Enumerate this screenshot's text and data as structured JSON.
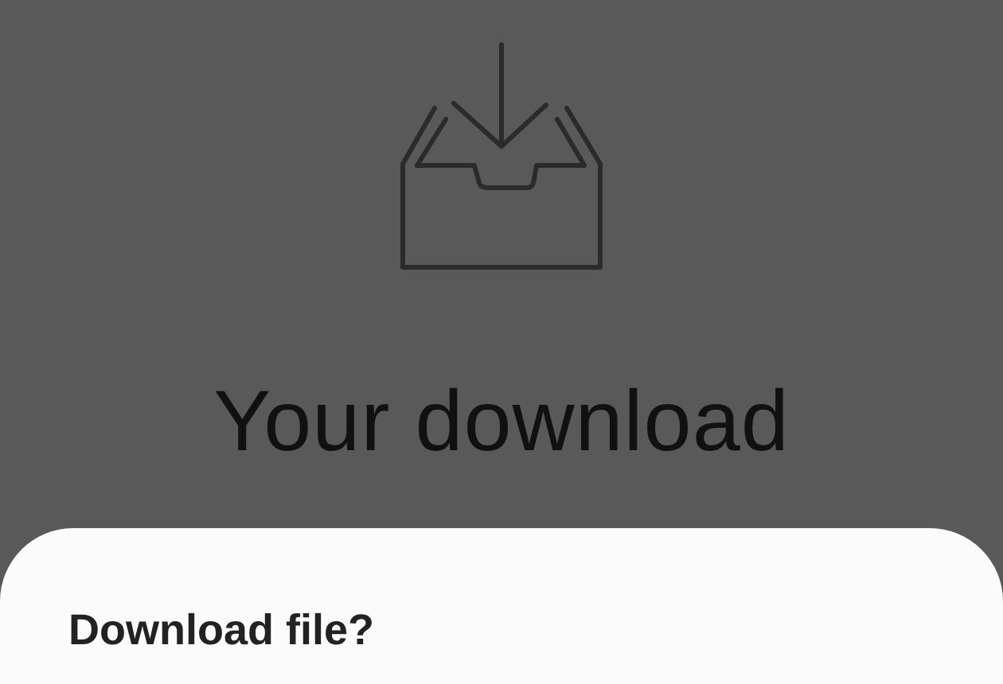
{
  "heading": "Your download",
  "sheet": {
    "title": "Download file?"
  }
}
